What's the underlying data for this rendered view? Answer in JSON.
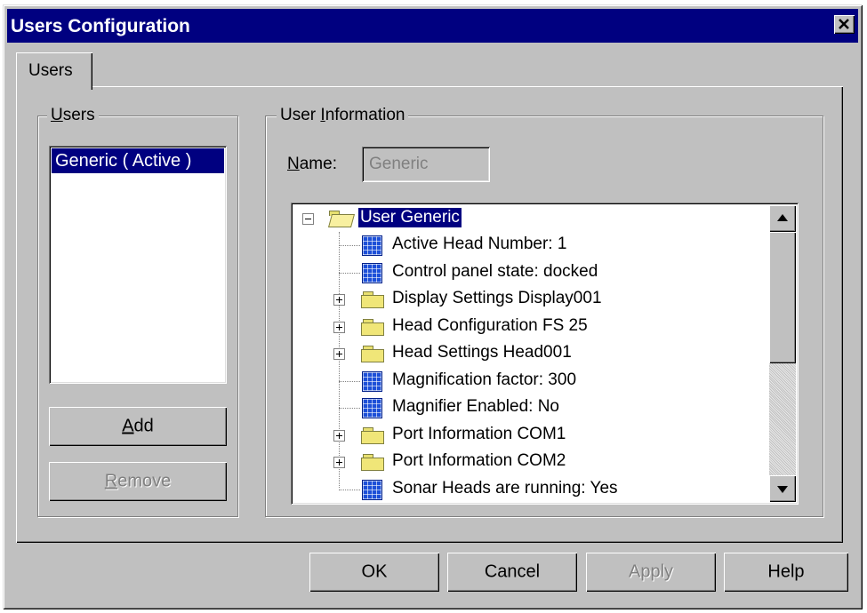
{
  "window": {
    "title": "Users Configuration",
    "close_glyph": "✕"
  },
  "tabs": [
    {
      "label": "Users"
    }
  ],
  "users_group": {
    "label_mnemonic": "U",
    "label_rest": "sers",
    "items": [
      {
        "label": "Generic ( Active )",
        "selected": true
      }
    ],
    "add_mnemonic": "A",
    "add_rest": "dd",
    "remove_mnemonic": "R",
    "remove_rest": "emove"
  },
  "info_group": {
    "label_pre": "User ",
    "label_mnemonic": "I",
    "label_rest": "nformation",
    "name_mnemonic": "N",
    "name_rest": "ame:",
    "name_value": "Generic"
  },
  "tree": {
    "root": {
      "label": "User Generic",
      "icon": "open-folder-icon"
    },
    "children": [
      {
        "label": "Active Head Number: 1",
        "icon": "grid-icon",
        "expandable": false
      },
      {
        "label": "Control panel state: docked",
        "icon": "grid-icon",
        "expandable": false
      },
      {
        "label": "Display Settings Display001",
        "icon": "folder-icon",
        "expandable": true
      },
      {
        "label": "Head Configuration FS 25",
        "icon": "folder-icon",
        "expandable": true
      },
      {
        "label": "Head Settings Head001",
        "icon": "folder-icon",
        "expandable": true
      },
      {
        "label": "Magnification factor: 300",
        "icon": "grid-icon",
        "expandable": false
      },
      {
        "label": "Magnifier Enabled: No",
        "icon": "grid-icon",
        "expandable": false
      },
      {
        "label": "Port Information COM1",
        "icon": "folder-icon",
        "expandable": true
      },
      {
        "label": "Port Information COM2",
        "icon": "folder-icon",
        "expandable": true
      },
      {
        "label": "Sonar Heads are running: Yes",
        "icon": "grid-icon",
        "expandable": false
      }
    ]
  },
  "buttons": {
    "ok": "OK",
    "cancel": "Cancel",
    "apply": "Apply",
    "help": "Help"
  },
  "colors": {
    "titlebar": "#000080",
    "selection": "#000080",
    "face": "#c0c0c0"
  }
}
